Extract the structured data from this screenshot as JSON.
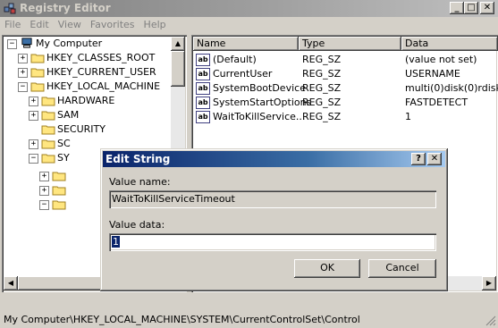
{
  "window": {
    "title": "Registry Editor",
    "minimize": "_",
    "maximize": "□",
    "close": "✕"
  },
  "menu": [
    "File",
    "Edit",
    "View",
    "Favorites",
    "Help"
  ],
  "tree": {
    "root": "My Computer",
    "items": [
      {
        "label": "HKEY_CLASSES_ROOT",
        "expander": "+"
      },
      {
        "label": "HKEY_CURRENT_USER",
        "expander": "+"
      },
      {
        "label": "HKEY_LOCAL_MACHINE",
        "expander": "−"
      },
      {
        "label": "HARDWARE",
        "expander": "+"
      },
      {
        "label": "SAM",
        "expander": "+"
      },
      {
        "label": "SECURITY",
        "expander": ""
      },
      {
        "label": "SC",
        "expander": "+"
      },
      {
        "label": "SY",
        "expander": "−"
      }
    ]
  },
  "list": {
    "headers": [
      "Name",
      "Type",
      "Data"
    ],
    "rows": [
      {
        "name": "(Default)",
        "type": "REG_SZ",
        "data": "(value not set)"
      },
      {
        "name": "CurrentUser",
        "type": "REG_SZ",
        "data": "USERNAME"
      },
      {
        "name": "SystemBootDevice",
        "type": "REG_SZ",
        "data": "multi(0)disk(0)rdisk"
      },
      {
        "name": "SystemStartOptions",
        "type": "REG_SZ",
        "data": "FASTDETECT"
      },
      {
        "name": "WaitToKillService...",
        "type": "REG_SZ",
        "data": "1"
      }
    ]
  },
  "dialog": {
    "title": "Edit String",
    "help": "?",
    "close": "✕",
    "value_name_label": "Value name:",
    "value_name": "WaitToKillServiceTimeout",
    "value_data_label": "Value data:",
    "value_data": "1",
    "ok": "OK",
    "cancel": "Cancel"
  },
  "status": "My Computer\\HKEY_LOCAL_MACHINE\\SYSTEM\\CurrentControlSet\\Control",
  "colors": {
    "active_title": "#0a246a",
    "inactive_title": "#808080",
    "face": "#d4d0c8"
  }
}
